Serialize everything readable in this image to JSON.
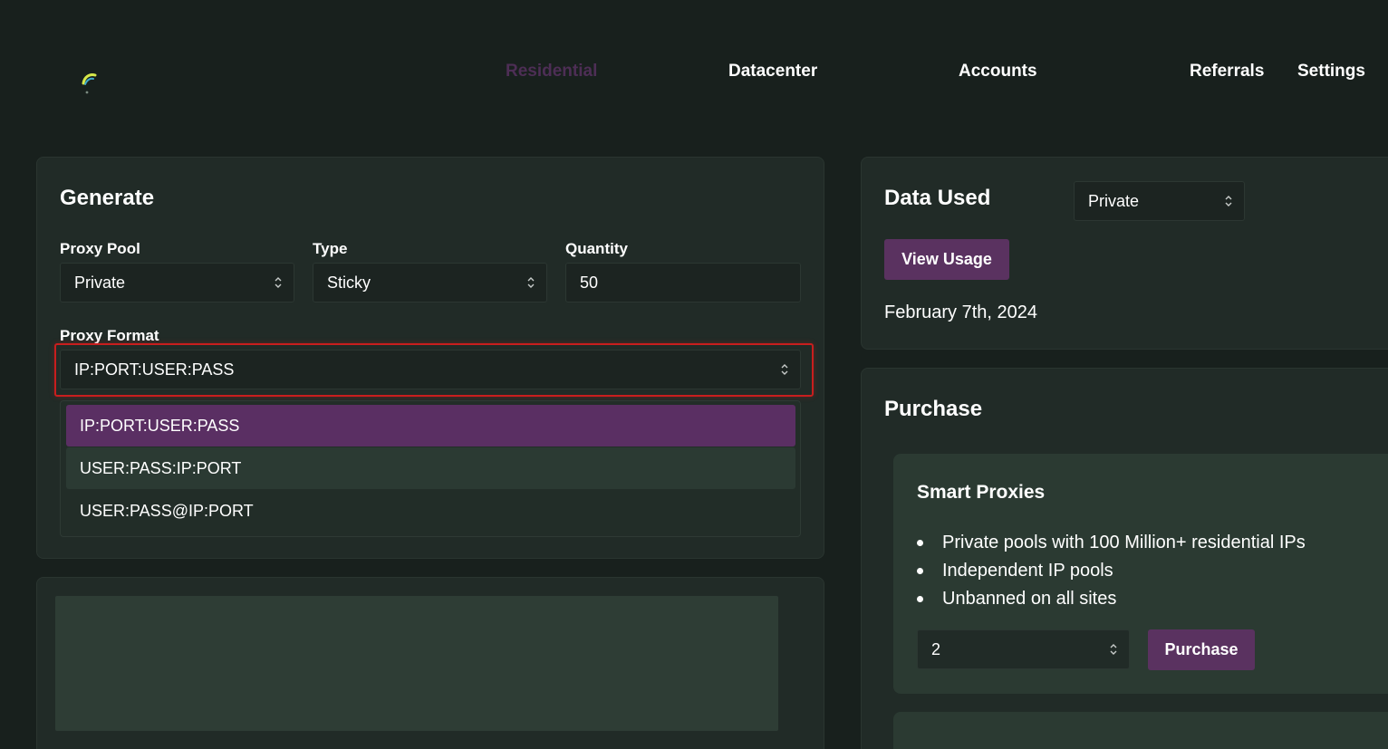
{
  "nav": {
    "items": [
      {
        "label": "Residential",
        "active": true
      },
      {
        "label": "Datacenter",
        "active": false
      },
      {
        "label": "Accounts",
        "active": false
      },
      {
        "label": "Referrals",
        "active": false
      },
      {
        "label": "Settings",
        "active": false
      }
    ]
  },
  "generate": {
    "title": "Generate",
    "proxy_pool": {
      "label": "Proxy Pool",
      "value": "Private"
    },
    "type": {
      "label": "Type",
      "value": "Sticky"
    },
    "quantity": {
      "label": "Quantity",
      "value": "50"
    },
    "proxy_format": {
      "label": "Proxy Format",
      "value": "IP:PORT:USER:PASS",
      "options": [
        "IP:PORT:USER:PASS",
        "USER:PASS:IP:PORT",
        "USER:PASS@IP:PORT"
      ]
    }
  },
  "data_used": {
    "title": "Data Used",
    "pool_select": "Private",
    "view_usage_label": "View Usage",
    "date": "February 7th, 2024"
  },
  "purchase": {
    "title": "Purchase",
    "smart_proxies": {
      "title": "Smart Proxies",
      "features": [
        "Private pools with 100 Million+ residential IPs",
        "Independent IP pools",
        "Unbanned on all sites"
      ],
      "quantity": "2",
      "button_label": "Purchase"
    }
  },
  "colors": {
    "background": "#18201d",
    "card": "#212b27",
    "accent": "#5a3260",
    "active_nav": "#4d2e55",
    "highlight": "#c81e1e"
  }
}
